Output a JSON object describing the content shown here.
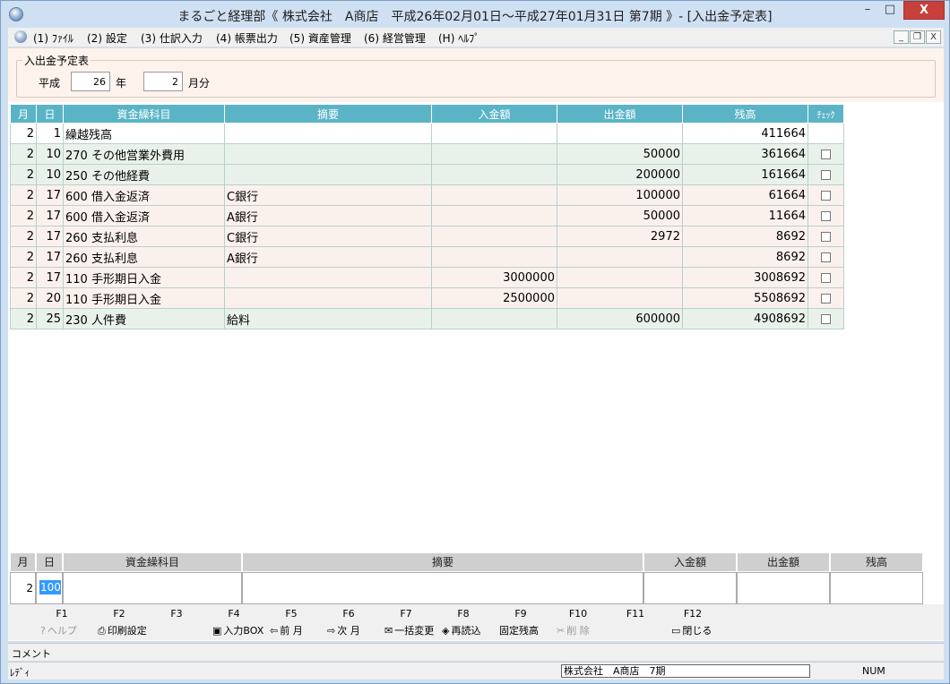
{
  "window": {
    "title": "まるごと経理部《 株式会社　A商店　平成26年02月01日～平成27年01月31日 第7期 》- [入出金予定表]",
    "minimize": "–",
    "maximize": "□",
    "close": "X"
  },
  "menu": {
    "items": [
      "(1) ﾌｧｲﾙ",
      "(2) 設定",
      "(3) 仕訳入力",
      "(4) 帳票出力",
      "(5) 資産管理",
      "(6) 経営管理",
      "(H) ﾍﾙﾌﾟ"
    ],
    "child_min": "_",
    "child_restore": "❐",
    "child_close": "X"
  },
  "filter": {
    "legend": "入出金予定表",
    "era": "平成",
    "year": "26",
    "year_unit": "年",
    "month": "2",
    "month_unit": "月分"
  },
  "grid": {
    "headers": {
      "month": "月",
      "day": "日",
      "account": "資金繰科目",
      "memo": "摘要",
      "in": "入金額",
      "out": "出金額",
      "balance": "残高",
      "check": "ﾁｪｯｸ"
    },
    "rows": [
      {
        "month": "2",
        "day": "1",
        "account": "繰越残高",
        "memo": "",
        "in": "",
        "out": "",
        "balance": "411664",
        "check": false,
        "style": "r0"
      },
      {
        "month": "2",
        "day": "10",
        "account": "270 その他営業外費用",
        "memo": "",
        "in": "",
        "out": "50000",
        "balance": "361664",
        "check": true,
        "style": "ra"
      },
      {
        "month": "2",
        "day": "10",
        "account": "250 その他経費",
        "memo": "",
        "in": "",
        "out": "200000",
        "balance": "161664",
        "check": true,
        "style": "ra"
      },
      {
        "month": "2",
        "day": "17",
        "account": "600 借入金返済",
        "memo": "C銀行",
        "in": "",
        "out": "100000",
        "balance": "61664",
        "check": true,
        "style": "rb"
      },
      {
        "month": "2",
        "day": "17",
        "account": "600 借入金返済",
        "memo": "A銀行",
        "in": "",
        "out": "50000",
        "balance": "11664",
        "check": true,
        "style": "rb"
      },
      {
        "month": "2",
        "day": "17",
        "account": "260 支払利息",
        "memo": "C銀行",
        "in": "",
        "out": "2972",
        "balance": "8692",
        "check": true,
        "style": "rb"
      },
      {
        "month": "2",
        "day": "17",
        "account": "260 支払利息",
        "memo": "A銀行",
        "in": "",
        "out": "",
        "balance": "8692",
        "check": true,
        "style": "rb"
      },
      {
        "month": "2",
        "day": "17",
        "account": "110 手形期日入金",
        "memo": "",
        "in": "3000000",
        "out": "",
        "balance": "3008692",
        "check": true,
        "style": "rb"
      },
      {
        "month": "2",
        "day": "20",
        "account": "110 手形期日入金",
        "memo": "",
        "in": "2500000",
        "out": "",
        "balance": "5508692",
        "check": true,
        "style": "rb"
      },
      {
        "month": "2",
        "day": "25",
        "account": "230 人件費",
        "memo": "給料",
        "in": "",
        "out": "600000",
        "balance": "4908692",
        "check": true,
        "style": "ra"
      }
    ]
  },
  "entry": {
    "headers": {
      "month": "月",
      "day": "日",
      "account": "資金繰科目",
      "memo": "摘要",
      "in": "入金額",
      "out": "出金額",
      "balance": "残高"
    },
    "month": "2",
    "day": "100"
  },
  "fkeys": [
    {
      "key": "F1",
      "label": "ヘルプ",
      "icon": "help-icon",
      "disabled": true
    },
    {
      "key": "F2",
      "label": "印刷設定",
      "icon": "printer-icon",
      "disabled": false
    },
    {
      "key": "F3",
      "label": "",
      "icon": "",
      "disabled": false
    },
    {
      "key": "F4",
      "label": "入力BOX",
      "icon": "input-box-icon",
      "disabled": false
    },
    {
      "key": "F5",
      "label": "前 月",
      "icon": "arrow-left-icon",
      "disabled": false
    },
    {
      "key": "F6",
      "label": "次 月",
      "icon": "arrow-right-icon",
      "disabled": false
    },
    {
      "key": "F7",
      "label": "一括変更",
      "icon": "batch-change-icon",
      "disabled": false
    },
    {
      "key": "F8",
      "label": "再読込",
      "icon": "reload-icon",
      "disabled": false
    },
    {
      "key": "F9",
      "label": "固定残高",
      "icon": "",
      "disabled": false
    },
    {
      "key": "F10",
      "label": "削 除",
      "icon": "scissors-icon",
      "disabled": true
    },
    {
      "key": "F11",
      "label": "",
      "icon": "",
      "disabled": false
    },
    {
      "key": "F12",
      "label": "閉じる",
      "icon": "folder-open-icon",
      "disabled": false
    }
  ],
  "comment_label": "コメント",
  "status": {
    "ready": "ﾚﾃﾞｨ",
    "company": "株式会社　A商店　7期",
    "num": "NUM"
  }
}
